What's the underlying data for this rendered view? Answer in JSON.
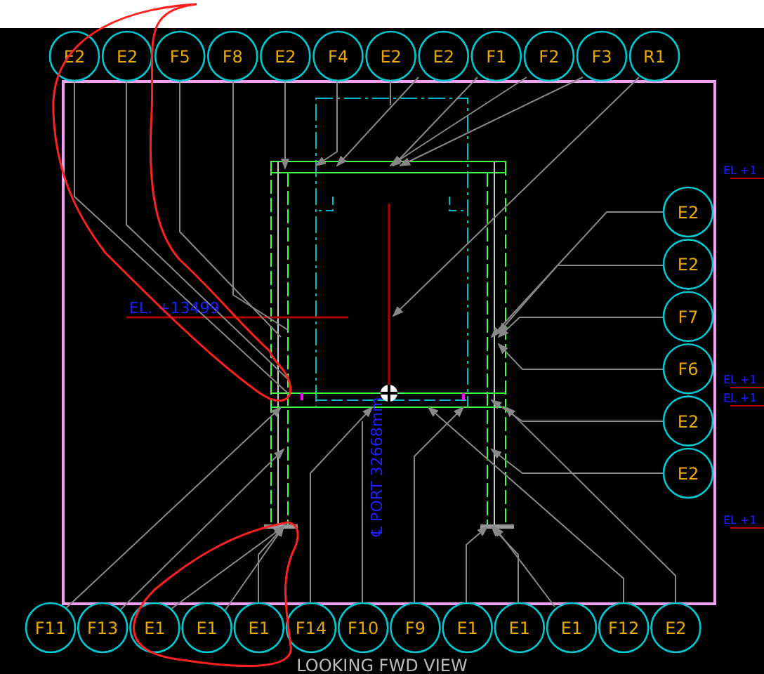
{
  "drawing": {
    "top_balloons": [
      "E2",
      "E2",
      "F5",
      "F8",
      "E2",
      "F4",
      "E2",
      "E2",
      "F1",
      "F2",
      "F3",
      "R1"
    ],
    "right_balloons": [
      "E2",
      "E2",
      "F7",
      "F6",
      "E2",
      "E2"
    ],
    "bottom_balloons": [
      "F11",
      "F13",
      "E1",
      "E1",
      "E1",
      "F14",
      "F10",
      "F9",
      "E1",
      "E1",
      "E1",
      "F12",
      "E2"
    ],
    "elevation_label": "EL. +13499",
    "centerline_label": "℄ PORT 32668mm",
    "edge_labels": [
      "EL +1",
      "EL +1",
      "EL +1",
      "EL +1"
    ],
    "view_title": "LOOKING FWD VIEW"
  }
}
